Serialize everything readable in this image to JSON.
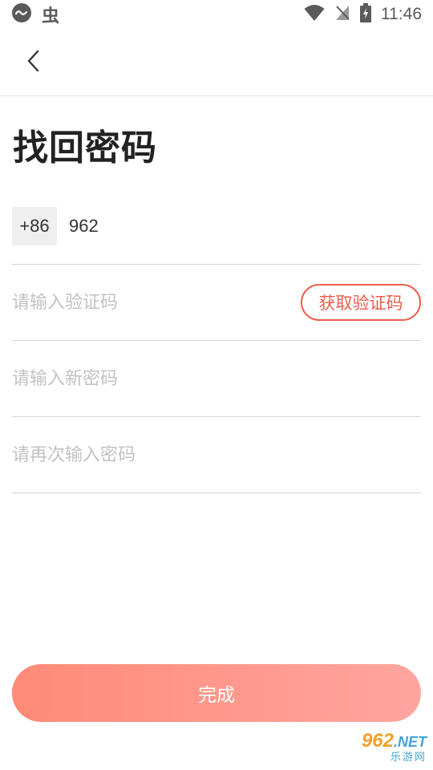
{
  "status_bar": {
    "app_glyph": "虫",
    "time": "11:46"
  },
  "title": "找回密码",
  "phone": {
    "country_code": "+86",
    "value": "962"
  },
  "code": {
    "placeholder": "请输入验证码",
    "button_label": "获取验证码"
  },
  "new_password": {
    "placeholder": "请输入新密码"
  },
  "confirm_password": {
    "placeholder": "请再次输入密码"
  },
  "submit_label": "完成",
  "watermark": {
    "brand": "962",
    "domain": ".NET",
    "subtitle": "乐游网"
  },
  "colors": {
    "accent": "#ec5c4b",
    "button_gradient_start": "#ff8a76",
    "button_gradient_end": "#ffa5a0",
    "placeholder": "#c2c2c2"
  }
}
